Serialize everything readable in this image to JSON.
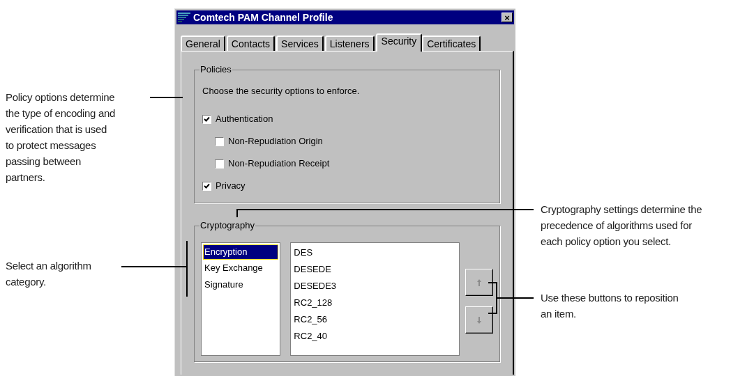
{
  "window": {
    "title": "Comtech PAM Channel Profile",
    "close": "×"
  },
  "tabs": [
    {
      "label": "General",
      "selected": false
    },
    {
      "label": "Contacts",
      "selected": false
    },
    {
      "label": "Services",
      "selected": false
    },
    {
      "label": "Listeners",
      "selected": false
    },
    {
      "label": "Security",
      "selected": true
    },
    {
      "label": "Certificates",
      "selected": false
    }
  ],
  "policies": {
    "label": "Policies",
    "prompt": "Choose the security options to enforce.",
    "options": [
      {
        "label": "Authentication",
        "checked": true,
        "children": [
          {
            "label": "Non-Repudiation Origin",
            "checked": false
          },
          {
            "label": "Non-Repudiation Receipt",
            "checked": false
          }
        ]
      },
      {
        "label": "Privacy",
        "checked": true
      }
    ]
  },
  "cryptography": {
    "label": "Cryptography",
    "categories": [
      {
        "label": "Encryption",
        "selected": true
      },
      {
        "label": "Key Exchange",
        "selected": false
      },
      {
        "label": "Signature",
        "selected": false
      }
    ],
    "algorithms": [
      "DES",
      "DESEDE",
      "DESEDE3",
      "RC2_128",
      "RC2_56",
      "RC2_40"
    ],
    "buttons": [
      {
        "kind": "up",
        "disabled": true
      },
      {
        "kind": "down",
        "disabled": true
      }
    ]
  },
  "callouts": [
    {
      "lines": [
        "Policy options determine",
        "the type of encoding and",
        "verification that is used",
        "to protect messages",
        "passing between",
        "partners."
      ]
    },
    {
      "lines": [
        "Cryptography settings determine the",
        "precedence of algorithms used for",
        "each policy option you select."
      ]
    },
    {
      "lines": [
        "Select an algorithm",
        "category."
      ]
    },
    {
      "lines": [
        "Use these buttons to reposition",
        "an item."
      ]
    }
  ]
}
